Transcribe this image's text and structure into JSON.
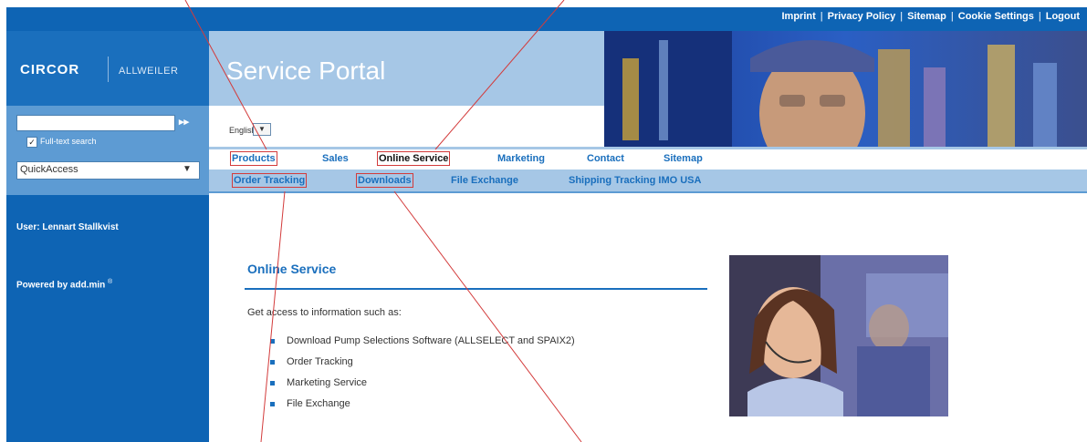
{
  "top_links": [
    "Imprint",
    "Privacy Policy",
    "Sitemap",
    "Cookie Settings",
    "Logout"
  ],
  "logo": {
    "brand": "CIRCOR",
    "sub": "ALLWEILER"
  },
  "header": {
    "title": "Service Portal"
  },
  "search": {
    "value": "",
    "go_icon": "double-arrow-right-icon",
    "fulltext_label": "Full-text search",
    "fulltext_checked": true
  },
  "quick_access": {
    "selected": "QuickAccess"
  },
  "language": {
    "selected": "English"
  },
  "user": {
    "label": "User: Lennart Stallkvist"
  },
  "powered": {
    "label": "Powered by add.min",
    "mark": "®"
  },
  "nav_primary": [
    "Products",
    "Sales",
    "Online Service",
    "Marketing",
    "Contact",
    "Sitemap"
  ],
  "nav_secondary": [
    "Order Tracking",
    "Downloads",
    "File Exchange",
    "Shipping Tracking IMO USA"
  ],
  "content": {
    "title": "Online Service",
    "intro": "Get access to information such as:",
    "bullets": [
      "Download Pump Selections Software (ALLSELECT and SPAIX2)",
      "Order Tracking",
      "Marketing Service",
      "File Exchange"
    ]
  },
  "colors": {
    "brand_blue": "#0e64b4",
    "light_blue": "#a6c7e6",
    "highlight_red": "#d33b3b"
  }
}
